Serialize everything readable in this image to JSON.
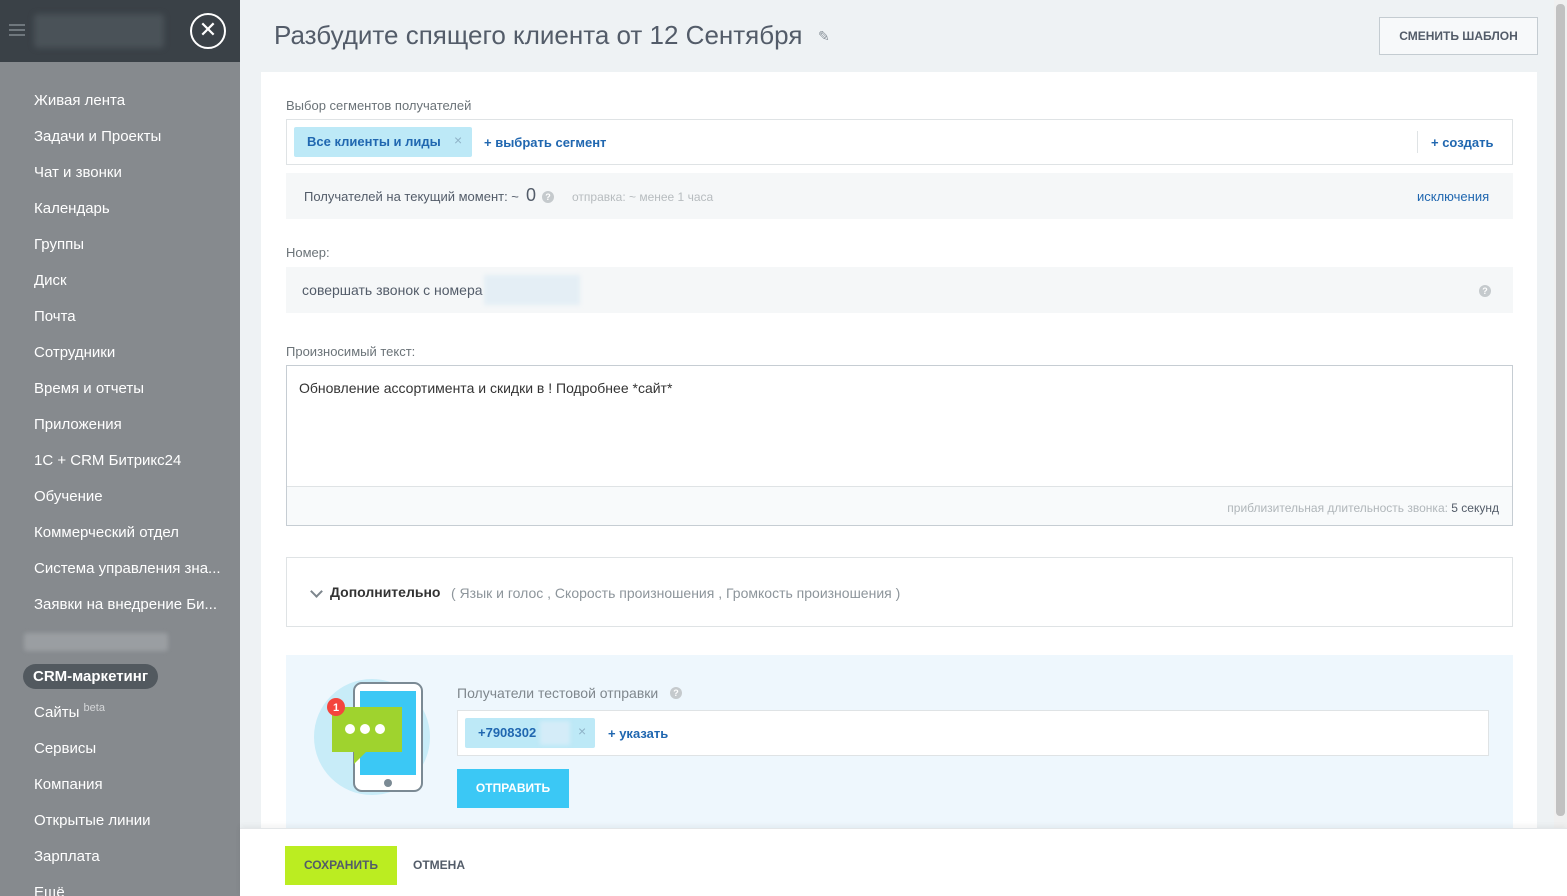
{
  "sidebar": {
    "close_glyph": "✕",
    "items": [
      {
        "label": "Живая лента"
      },
      {
        "label": "Задачи и Проекты"
      },
      {
        "label": "Чат и звонки"
      },
      {
        "label": "Календарь"
      },
      {
        "label": "Группы"
      },
      {
        "label": "Диск"
      },
      {
        "label": "Почта"
      },
      {
        "label": "Сотрудники"
      },
      {
        "label": "Время и отчеты"
      },
      {
        "label": "Приложения"
      },
      {
        "label": "1С + CRM Битрикс24"
      },
      {
        "label": "Обучение"
      },
      {
        "label": "Коммерческий отдел"
      },
      {
        "label": "Система управления зна..."
      },
      {
        "label": "Заявки на внедрение Би..."
      }
    ],
    "active_item": "CRM-маркетинг",
    "sites": {
      "label": "Сайты",
      "badge": "beta"
    },
    "items_after": [
      {
        "label": "Сервисы"
      },
      {
        "label": "Компания"
      },
      {
        "label": "Открытые линии"
      },
      {
        "label": "Зарплата"
      },
      {
        "label": "Ещё"
      }
    ]
  },
  "header": {
    "title": "Разбудите спящего клиента от 12 Сентября",
    "edit_glyph": "✎",
    "template_button": "СМЕНИТЬ ШАБЛОН"
  },
  "segments": {
    "label": "Выбор сегментов получателей",
    "tag": "Все клиенты и лиды",
    "tag_remove": "×",
    "choose_link": "+ выбрать сегмент",
    "create_link": "+ создать"
  },
  "recipients": {
    "text": "Получателей на текущий момент: ~",
    "count": "0",
    "help": "?",
    "send_time": "отправка: ~ менее 1 часа",
    "exclusions_link": "исключения"
  },
  "number": {
    "label": "Номер:",
    "text": "совершать звонок с номера",
    "help": "?"
  },
  "speech": {
    "label": "Произносимый текст:",
    "value": "Обновление ассортимента и скидки в ! Подробнее *сайт*",
    "duration_prefix": "приблизительная длительность звонка:",
    "duration_value": "5 секунд"
  },
  "additional": {
    "title": "Дополнительно",
    "options": "( Язык и голос ,  Скорость произношения ,  Громкость произношения  )"
  },
  "test_send": {
    "label": "Получатели тестовой отправки",
    "help": "?",
    "phone_tag": "+7908302",
    "tag_remove": "×",
    "add_link": "+ указать",
    "send_button": "ОТПРАВИТЬ",
    "notification_count": "1"
  },
  "footer": {
    "save_button": "СОХРАНИТЬ",
    "cancel_button": "ОТМЕНА"
  },
  "colors": {
    "sidebar_bg": "#868a8e",
    "accent_blue": "#2067b0",
    "tag_bg": "#bde9f7",
    "send_button": "#3bc8f5",
    "save_button": "#bbed21"
  }
}
